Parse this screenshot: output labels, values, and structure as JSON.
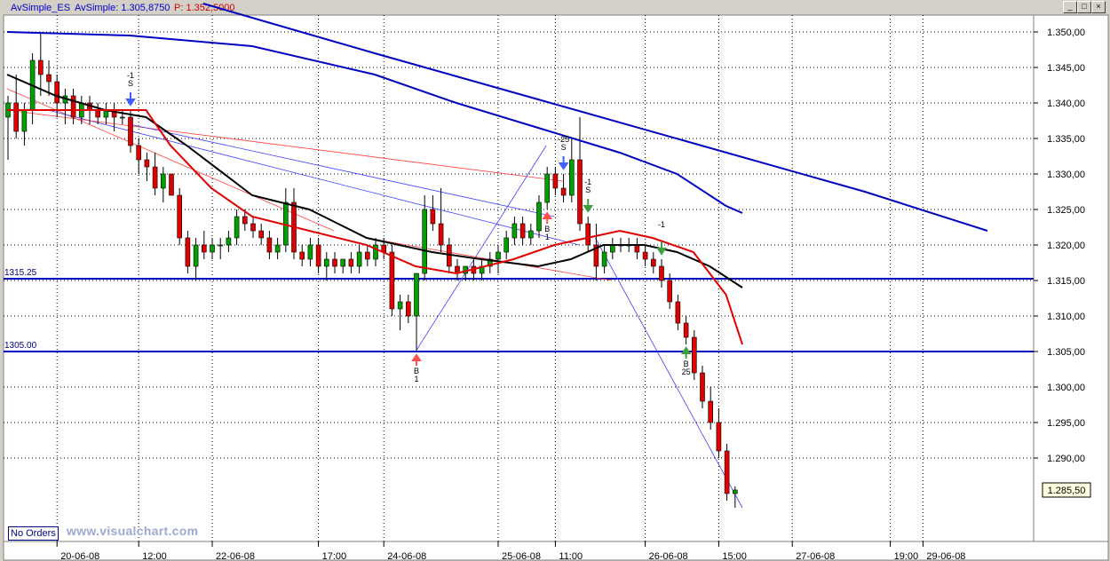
{
  "window": {
    "title_symbol": "AvSimple_ES",
    "title_indicator": "AvSimple: 1.305,8750",
    "title_price": "P: 1.352,5000",
    "buttons": [
      "_",
      "□",
      "×"
    ]
  },
  "status": {
    "orders_label": "No Orders",
    "watermark": "www.visualchart.com"
  },
  "colors": {
    "background": "#ffffff",
    "grid": "#000000",
    "up_candle": "#00a000",
    "down_candle": "#e00000",
    "long_trend": "#0000c0",
    "sma_fast": "#e00000",
    "sma_mid": "#000000",
    "channel_blue": "#4040ff",
    "channel_red": "#ff4040",
    "buy_arrow": "#ff5050",
    "sell_arrow": "#4060ff",
    "exit_arrow": "#40a040"
  },
  "chart_data": {
    "type": "candlestick",
    "grid": true,
    "ylim": [
      1281,
      1352.5
    ],
    "y_ticks": [
      "1.350,00",
      "1.345,00",
      "1.340,00",
      "1.335,00",
      "1.330,00",
      "1.325,00",
      "1.320,00",
      "1.315,00",
      "1.310,00",
      "1.305,00",
      "1.300,00",
      "1.295,00",
      "1.290,00"
    ],
    "y_tick_values": [
      1350,
      1345,
      1340,
      1335,
      1330,
      1325,
      1320,
      1315,
      1310,
      1305,
      1300,
      1295,
      1290
    ],
    "x_labels": [
      "20-06-08",
      "12:00",
      "22-06-08",
      "17:00",
      "24-06-08",
      "25-06-08",
      "11:00",
      "26-06-08",
      "15:00",
      "27-06-08",
      "19:00",
      "29-06-08"
    ],
    "x_label_bars": [
      6,
      16,
      25,
      38,
      46,
      60,
      67,
      78,
      87,
      96,
      108,
      112
    ],
    "last_price_label": "1.285,50",
    "last_price": 1285.5,
    "hlines": [
      {
        "label": "1315.25",
        "value": 1315.25
      },
      {
        "label": "1305.00",
        "value": 1305.0
      }
    ],
    "candles": [
      [
        1338,
        1341,
        1332,
        1340
      ],
      [
        1340,
        1344,
        1335,
        1336
      ],
      [
        1336,
        1340,
        1334,
        1339
      ],
      [
        1339,
        1347,
        1337,
        1346
      ],
      [
        1346,
        1350,
        1341,
        1344
      ],
      [
        1344,
        1346,
        1341,
        1343
      ],
      [
        1343,
        1344,
        1338,
        1340
      ],
      [
        1340,
        1342,
        1337,
        1341
      ],
      [
        1341,
        1342,
        1337,
        1338
      ],
      [
        1338,
        1341,
        1337,
        1340
      ],
      [
        1340,
        1341,
        1337,
        1339
      ],
      [
        1339,
        1340,
        1337,
        1338
      ],
      [
        1338,
        1340,
        1337,
        1339
      ],
      [
        1339,
        1340,
        1336,
        1338
      ],
      [
        1338,
        1339,
        1337,
        1338
      ],
      [
        1338,
        1339,
        1333,
        1334
      ],
      [
        1334,
        1335,
        1330,
        1332
      ],
      [
        1332,
        1333,
        1329,
        1331
      ],
      [
        1331,
        1333,
        1327,
        1328
      ],
      [
        1328,
        1331,
        1326,
        1330
      ],
      [
        1330,
        1330,
        1327,
        1327
      ],
      [
        1327,
        1328,
        1320,
        1321
      ],
      [
        1321,
        1322,
        1316,
        1317
      ],
      [
        1317,
        1321,
        1315,
        1320
      ],
      [
        1320,
        1322,
        1318,
        1319
      ],
      [
        1319,
        1321,
        1318,
        1320
      ],
      [
        1320,
        1321,
        1318,
        1320
      ],
      [
        1320,
        1322,
        1319,
        1321
      ],
      [
        1321,
        1325,
        1320,
        1324
      ],
      [
        1324,
        1325,
        1322,
        1323
      ],
      [
        1323,
        1324,
        1321,
        1322
      ],
      [
        1322,
        1323,
        1320,
        1321
      ],
      [
        1321,
        1322,
        1318,
        1319
      ],
      [
        1319,
        1321,
        1318,
        1320
      ],
      [
        1320,
        1328,
        1319,
        1326
      ],
      [
        1326,
        1328,
        1318,
        1319
      ],
      [
        1319,
        1320,
        1317,
        1318
      ],
      [
        1318,
        1321,
        1317,
        1320
      ],
      [
        1320,
        1321,
        1316,
        1317
      ],
      [
        1317,
        1319,
        1315,
        1318
      ],
      [
        1318,
        1319,
        1316,
        1317
      ],
      [
        1317,
        1318,
        1316,
        1318
      ],
      [
        1318,
        1319,
        1316,
        1317
      ],
      [
        1317,
        1320,
        1316,
        1319
      ],
      [
        1319,
        1320,
        1317,
        1318
      ],
      [
        1318,
        1321,
        1317,
        1320
      ],
      [
        1320,
        1321,
        1318,
        1319
      ],
      [
        1319,
        1320,
        1310,
        1311
      ],
      [
        1311,
        1313,
        1308,
        1312
      ],
      [
        1312,
        1313,
        1309,
        1310
      ],
      [
        1310,
        1316,
        1305,
        1316
      ],
      [
        1316,
        1327,
        1315,
        1325
      ],
      [
        1325,
        1327,
        1322,
        1323
      ],
      [
        1323,
        1328,
        1319,
        1320
      ],
      [
        1320,
        1321,
        1316,
        1317
      ],
      [
        1317,
        1318,
        1315,
        1316
      ],
      [
        1316,
        1317,
        1315,
        1317
      ],
      [
        1317,
        1318,
        1315,
        1316
      ],
      [
        1316,
        1318,
        1315,
        1317
      ],
      [
        1317,
        1319,
        1316,
        1318
      ],
      [
        1318,
        1320,
        1316,
        1319
      ],
      [
        1319,
        1322,
        1318,
        1321
      ],
      [
        1321,
        1324,
        1320,
        1323
      ],
      [
        1323,
        1324,
        1320,
        1321
      ],
      [
        1321,
        1323,
        1320,
        1322
      ],
      [
        1322,
        1327,
        1321,
        1326
      ],
      [
        1326,
        1331,
        1325,
        1330
      ],
      [
        1330,
        1331,
        1327,
        1328
      ],
      [
        1328,
        1330,
        1326,
        1327
      ],
      [
        1327,
        1335,
        1326,
        1332
      ],
      [
        1332,
        1338,
        1322,
        1323
      ],
      [
        1323,
        1324,
        1319,
        1320
      ],
      [
        1320,
        1323,
        1315,
        1317
      ],
      [
        1317,
        1320,
        1316,
        1319
      ],
      [
        1319,
        1321,
        1318,
        1320
      ],
      [
        1320,
        1321,
        1319,
        1320
      ],
      [
        1320,
        1321,
        1319,
        1320
      ],
      [
        1320,
        1321,
        1318,
        1319
      ],
      [
        1319,
        1320,
        1317,
        1318
      ],
      [
        1318,
        1319,
        1316,
        1317
      ],
      [
        1317,
        1318,
        1314,
        1315
      ],
      [
        1315,
        1316,
        1311,
        1312
      ],
      [
        1312,
        1313,
        1308,
        1309
      ],
      [
        1309,
        1310,
        1306,
        1307
      ],
      [
        1307,
        1308,
        1301,
        1302
      ],
      [
        1302,
        1303,
        1297,
        1298
      ],
      [
        1298,
        1300,
        1294,
        1295
      ],
      [
        1295,
        1297,
        1290,
        1291
      ],
      [
        1291,
        1292,
        1284,
        1285
      ],
      [
        1285,
        1286,
        1283,
        1285.5
      ]
    ],
    "series": [
      {
        "name": "",
        "values": [
          [
            0,
            1344
          ],
          [
            6,
            1341
          ],
          [
            12,
            1339
          ],
          [
            17,
            1338
          ],
          [
            22,
            1334
          ],
          [
            30,
            1327
          ],
          [
            37,
            1325
          ],
          [
            44,
            1321
          ],
          [
            52,
            1319
          ],
          [
            58,
            1318
          ],
          [
            65,
            1317
          ],
          [
            69,
            1318
          ],
          [
            73,
            1320
          ],
          [
            78,
            1320
          ],
          [
            82,
            1319
          ],
          [
            86,
            1317
          ],
          [
            90,
            1314
          ]
        ]
      },
      {
        "name": "",
        "values": [
          [
            0,
            1339
          ],
          [
            6,
            1339
          ],
          [
            12,
            1339
          ],
          [
            17,
            1339
          ],
          [
            20,
            1334
          ],
          [
            25,
            1328
          ],
          [
            30,
            1324
          ],
          [
            37,
            1322
          ],
          [
            44,
            1320
          ],
          [
            50,
            1317
          ],
          [
            55,
            1316
          ],
          [
            62,
            1318
          ],
          [
            67,
            1320
          ],
          [
            71,
            1321
          ],
          [
            75,
            1322
          ],
          [
            79,
            1321
          ],
          [
            84,
            1319
          ],
          [
            88,
            1313
          ],
          [
            90,
            1306
          ]
        ]
      },
      {
        "name": "",
        "values": [
          [
            0,
            1350
          ],
          [
            15,
            1349.5
          ],
          [
            30,
            1348
          ],
          [
            45,
            1344
          ],
          [
            55,
            1340
          ],
          [
            65,
            1336.5
          ],
          [
            75,
            1333
          ],
          [
            82,
            1330
          ],
          [
            88,
            1325.5
          ],
          [
            90,
            1324.5
          ]
        ]
      },
      {
        "name": "",
        "values": [
          [
            24,
            1354
          ],
          [
            45,
            1347
          ],
          [
            65,
            1340.5
          ],
          [
            85,
            1334
          ],
          [
            105,
            1327.5
          ],
          [
            120,
            1322
          ]
        ]
      }
    ],
    "signals": [
      {
        "bar": 15,
        "dir": "sell",
        "texts": [
          "-1",
          "S"
        ]
      },
      {
        "bar": 50,
        "dir": "buy",
        "texts": [
          "B",
          "1"
        ]
      },
      {
        "bar": 66,
        "dir": "buy",
        "texts": [
          "B",
          "1"
        ]
      },
      {
        "bar": 68,
        "dir": "sell",
        "texts": [
          "-25",
          "S"
        ]
      },
      {
        "bar": 71,
        "dir": "exit",
        "texts": [
          "-1",
          "S"
        ]
      },
      {
        "bar": 80,
        "dir": "exit",
        "texts": [
          "-1"
        ]
      },
      {
        "bar": 83,
        "dir": "exitbuy",
        "texts": [
          "B",
          "25"
        ]
      }
    ]
  }
}
